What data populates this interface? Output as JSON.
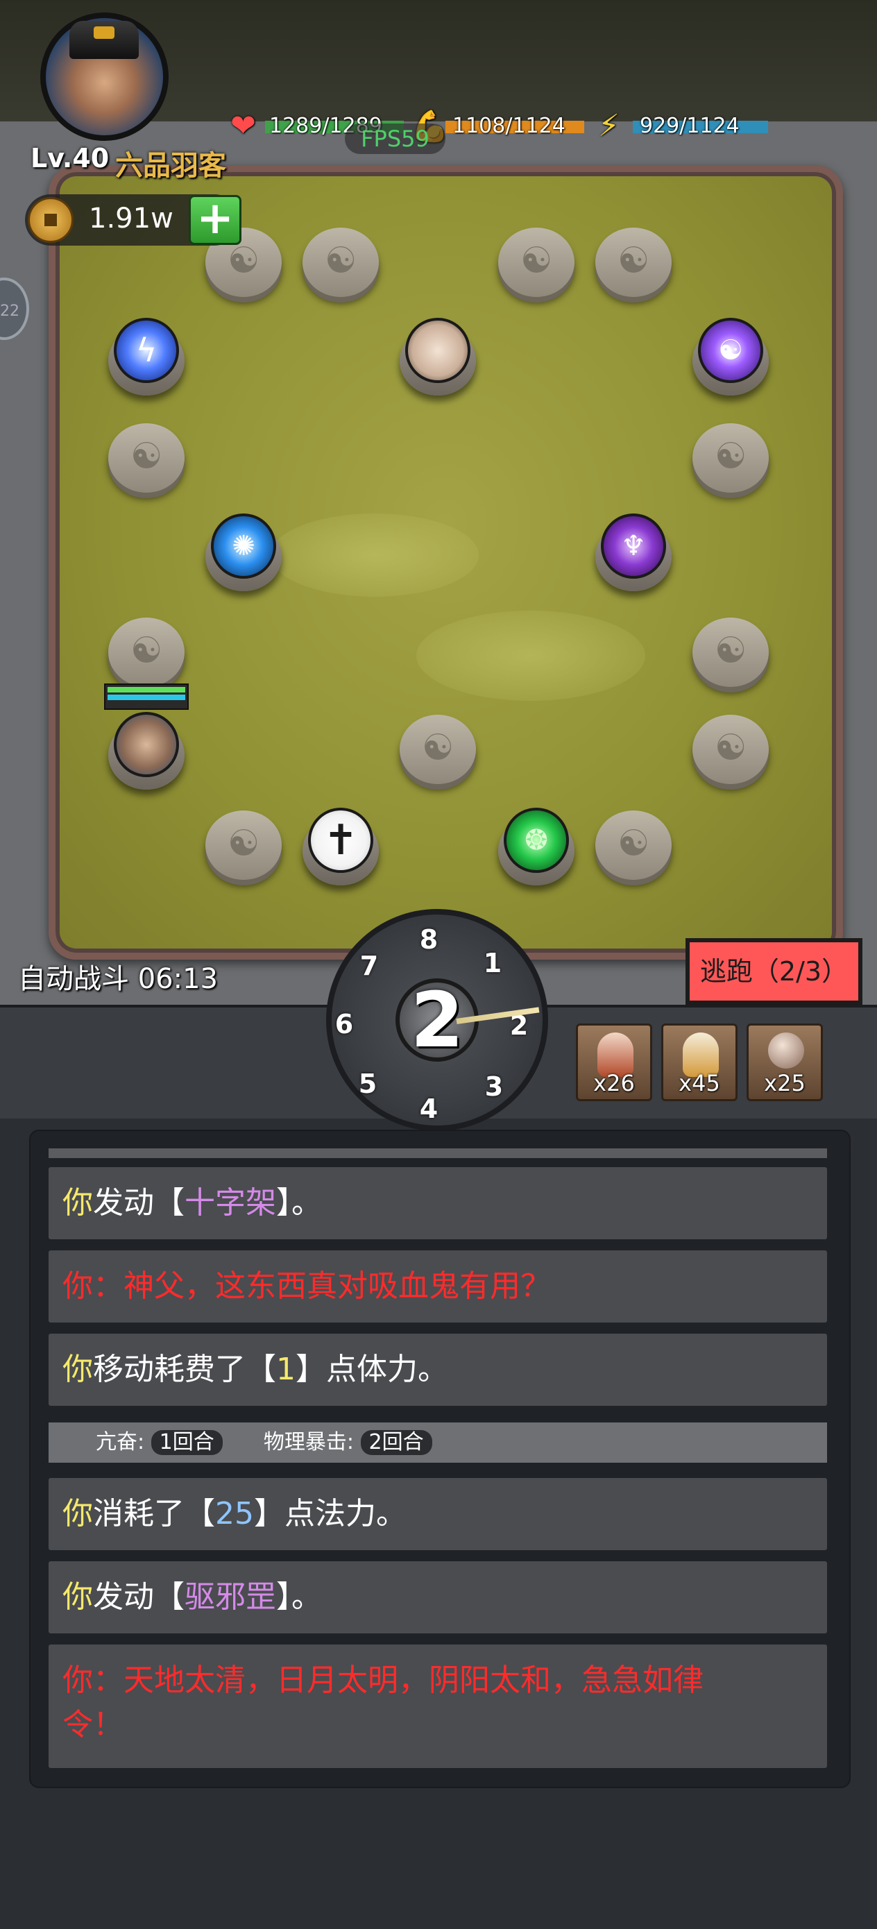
{
  "player": {
    "level": "Lv.40",
    "rank": "六品羽客",
    "hp": "1289/1289",
    "stamina": "1108/1124",
    "mana": "929/1124",
    "coins": "1.91w",
    "plus_label": "+"
  },
  "fps": "FPS59",
  "side_bubble": "22",
  "battle": {
    "auto_label": "自动战斗 06:13",
    "escape_label": "逃跑（2/3）",
    "dice_value": "2",
    "dice_labels": [
      "8",
      "1",
      "2",
      "3",
      "4",
      "5",
      "6",
      "7"
    ]
  },
  "items": [
    {
      "name": "red-potion",
      "count": "x26"
    },
    {
      "name": "yellow-potion",
      "count": "x45"
    },
    {
      "name": "pearl",
      "count": "x25"
    }
  ],
  "board": {
    "nodes": [
      {
        "kind": "lightning",
        "icon": "lightning-orb-icon"
      },
      {
        "kind": "girl",
        "icon": "female-npc-portrait"
      },
      {
        "kind": "bagua",
        "icon": "bagua-orb-icon"
      },
      {
        "kind": "galaxy",
        "icon": "galaxy-orb-icon"
      },
      {
        "kind": "demon",
        "icon": "demon-orb-icon"
      },
      {
        "kind": "player",
        "icon": "player-portrait"
      },
      {
        "kind": "cross",
        "icon": "cross-icon"
      },
      {
        "kind": "poison",
        "icon": "poison-orb-icon"
      }
    ]
  },
  "log": {
    "m1_you": "你",
    "m1_a": "发动【",
    "m1_skill": "十字架",
    "m1_b": "】。",
    "m2": "你：神父，这东西真对吸血鬼有用？",
    "m3_you": "你",
    "m3_a": "移动耗费了【",
    "m3_num": "1",
    "m3_b": "】点体力。",
    "status_1": "亢奋: ",
    "status_1_val": "1回合",
    "status_2": "物理暴击: ",
    "status_2_val": "2回合",
    "m4_you": "你",
    "m4_a": "消耗了【",
    "m4_num": "25",
    "m4_b": "】点法力。",
    "m5_you": "你",
    "m5_a": "发动【",
    "m5_skill": "驱邪罡",
    "m5_b": "】。",
    "m6_line1": "你：天地太清，日月太明，阴阳太和，急急如律",
    "m6_line2": "令！"
  },
  "colors": {
    "hp_bar": "#3fa24a",
    "stamina_bar": "#e08a1e",
    "mana_bar": "#2f8fb8",
    "escape": "#ff5757",
    "you_text": "#f6e96b",
    "skill_text": "#d58ae8",
    "red_text": "#ff2b2b"
  }
}
